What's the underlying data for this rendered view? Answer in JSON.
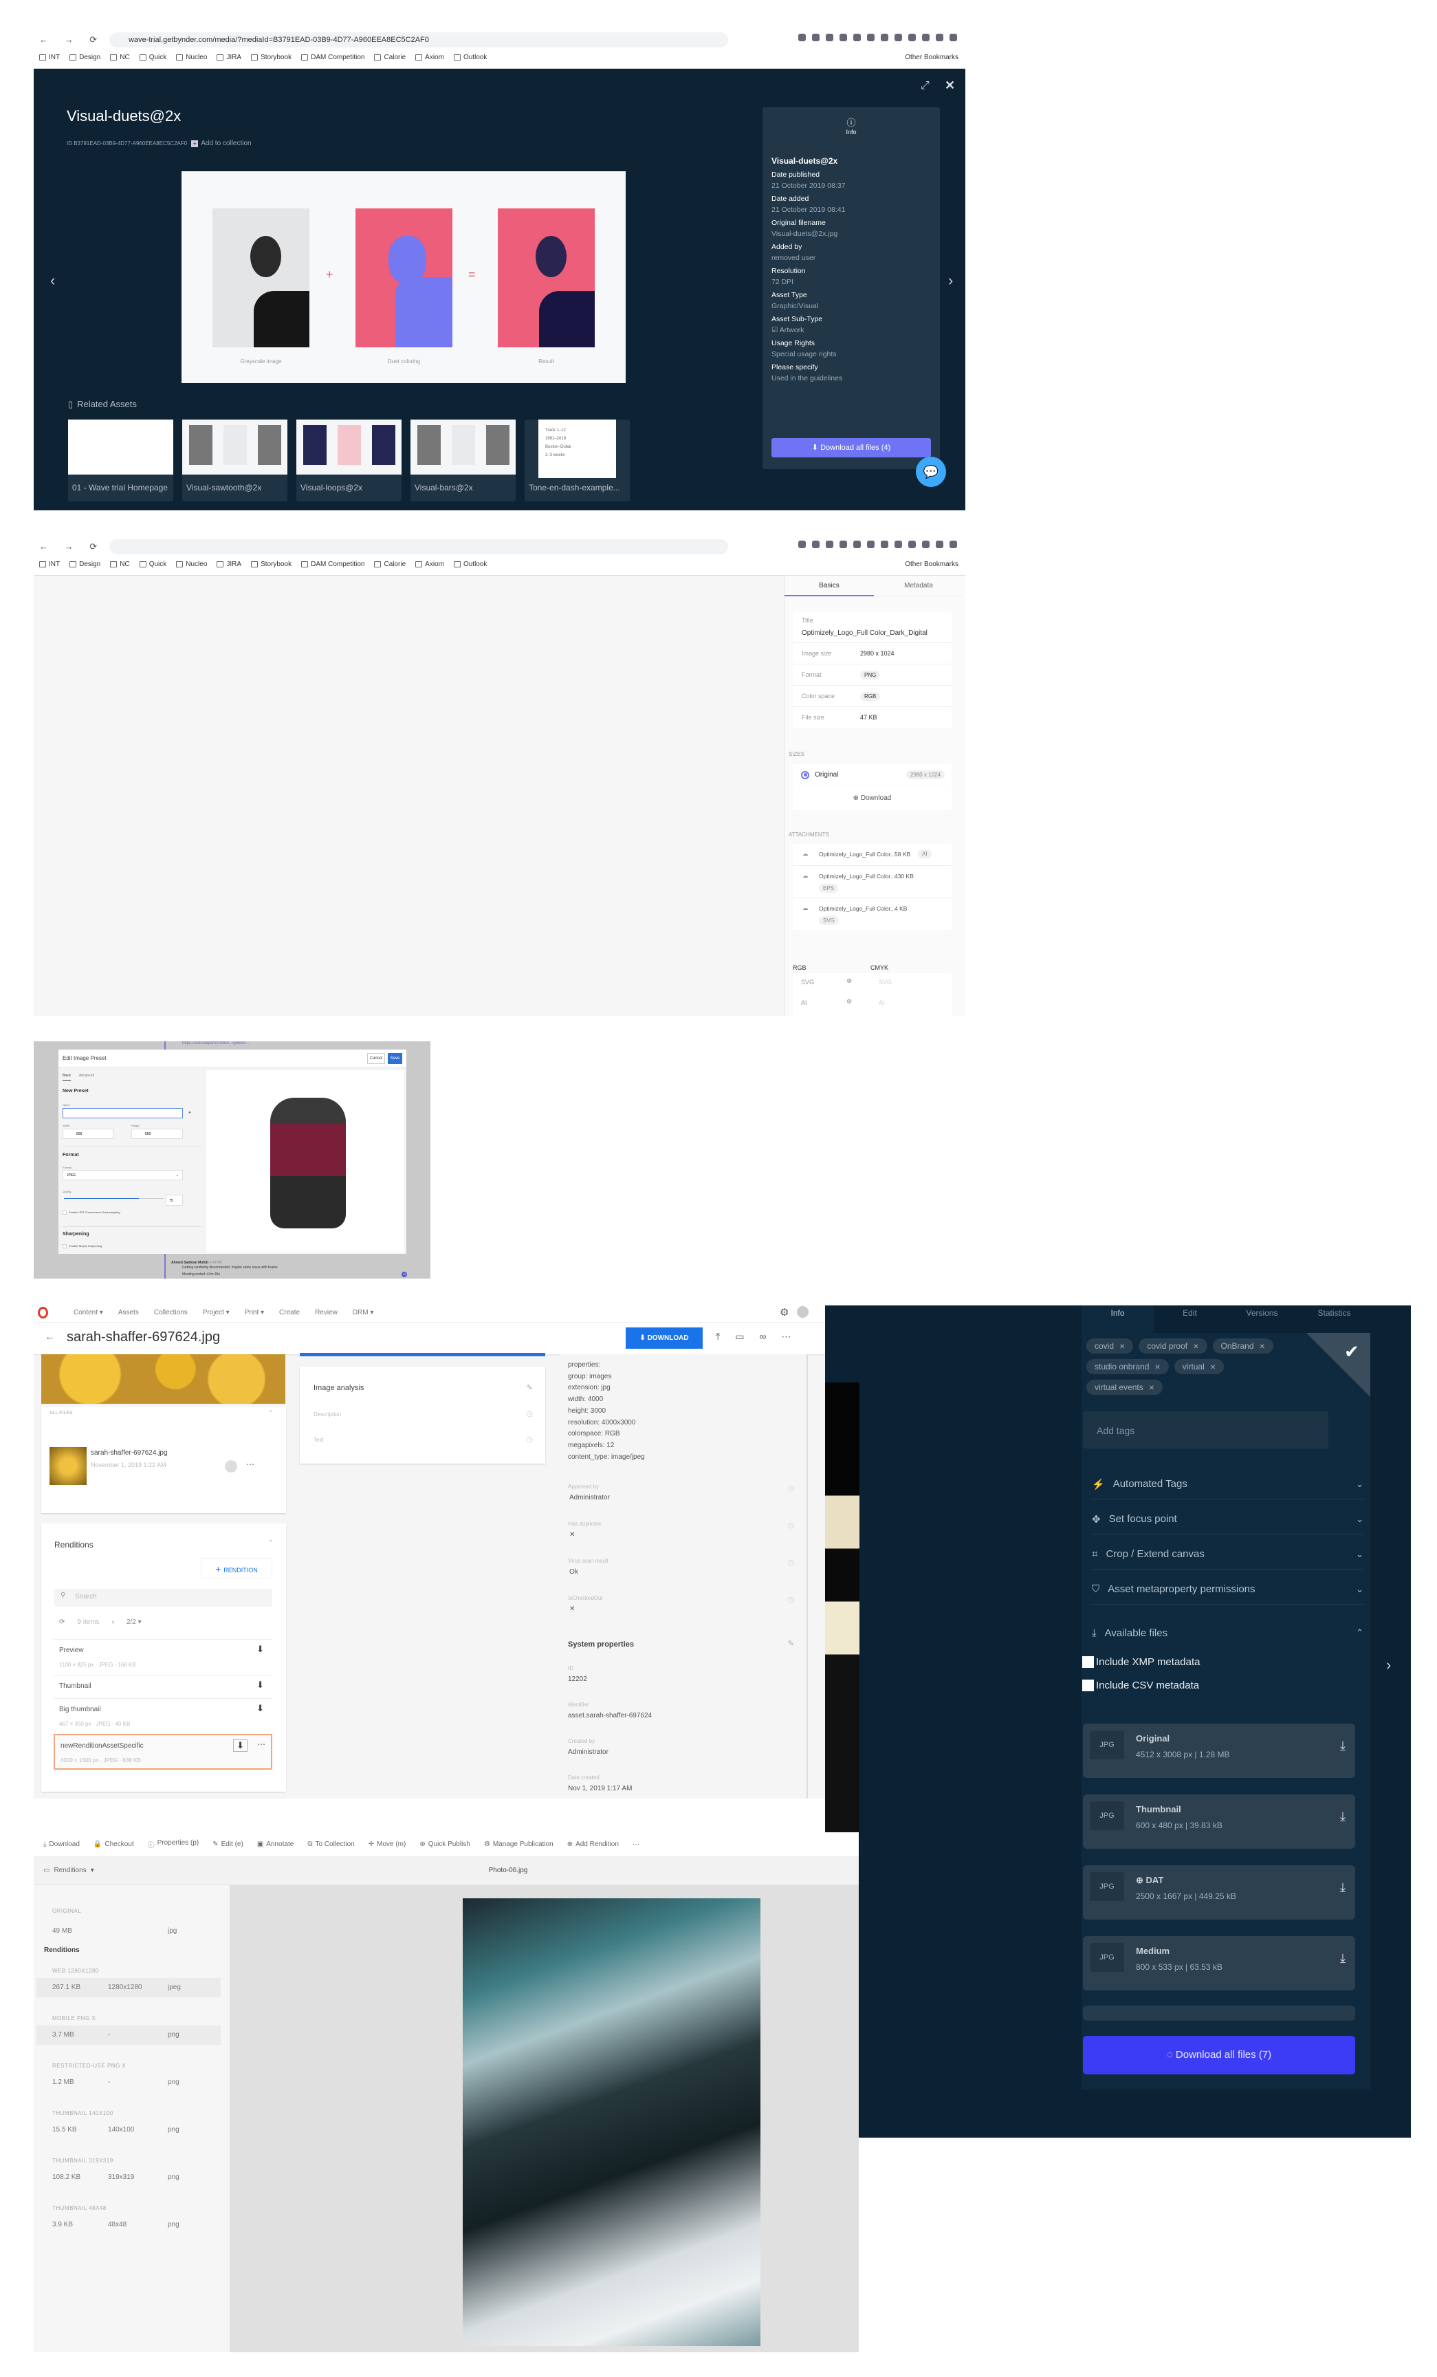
{
  "browser": {
    "bookmarks": [
      "INT",
      "Design",
      "NC",
      "Quick",
      "Nucleo",
      "JIRA",
      "Storybook",
      "DAM Competition",
      "Calorie",
      "Axiom",
      "Outlook"
    ],
    "other_bookmarks": "Other Bookmarks"
  },
  "p1": {
    "url": "wave-trial.getbynder.com/media/?mediaId=B3791EAD-03B9-4D77-A960EEA8EC5C2AF0",
    "title": "Visual-duets@2x",
    "id_line": "ID B3791EAD-03B9-4D77-A960EEA8EC5C2AF0",
    "add_to_collection": "Add to collection",
    "captions": [
      "Greyscale image",
      "Duet coloring",
      "Result"
    ],
    "operators": [
      "+",
      "="
    ],
    "related_label": "Related Assets",
    "related": [
      "01 - Wave trial Homepage",
      "Visual-sawtooth@2x",
      "Visual-loops@2x",
      "Visual-bars@2x",
      "Tone-en-dash-example..."
    ],
    "tone_lines": [
      "Track 1–12",
      "1991–2019",
      "Boston–Dubai",
      "2–3 weeks"
    ],
    "info_tab": "Info",
    "info_title": "Visual-duets@2x",
    "fields": [
      {
        "label": "Date published",
        "value": "21 October 2019 08:37"
      },
      {
        "label": "Date added",
        "value": "21 October 2019 08:41"
      },
      {
        "label": "Original filename",
        "value": "Visual-duets@2x.jpg"
      },
      {
        "label": "Added by",
        "value": "removed user"
      },
      {
        "label": "Resolution",
        "value": "72 DPI"
      },
      {
        "label": "Asset Type",
        "value": "Graphic/Visual"
      },
      {
        "label": "Asset Sub-Type",
        "value": "Artwork"
      },
      {
        "label": "Usage Rights",
        "value": "Special usage rights"
      },
      {
        "label": "Please specify",
        "value": "Used in the guidelines"
      }
    ],
    "download_all": "Download all files (4)",
    "colors": {
      "bg": "#0d2233",
      "panel": "#213747",
      "accent": "#6f74f4",
      "pink": "#ec5e79",
      "violet": "#7479f2",
      "chat": "#3da9fc"
    }
  },
  "p2": {
    "tabs": [
      "Basics",
      "Metadata"
    ],
    "title_label": "Title",
    "title_value": "Optimizely_Logo_Full Color_Dark_Digital",
    "rows": [
      {
        "label": "Image size",
        "value": "2980 x 1024",
        "pill": false
      },
      {
        "label": "Format",
        "value": "PNG",
        "pill": true
      },
      {
        "label": "Color space",
        "value": "RGB",
        "pill": true
      },
      {
        "label": "File size",
        "value": "47 KB",
        "pill": false
      }
    ],
    "sizes_label": "SIZES",
    "size_option": "Original",
    "size_dims": "2980 x 1024",
    "download": "Download",
    "attachments_label": "ATTACHMENTS",
    "attachments": [
      {
        "name": "Optimizely_Logo_Full Color...",
        "size": "58 KB",
        "type": "AI"
      },
      {
        "name": "Optimizely_Logo_Full Color...",
        "size": "430 KB",
        "type": "EPS"
      },
      {
        "name": "Optimizely_Logo_Full Color...",
        "size": "4 KB",
        "type": "SVG"
      }
    ],
    "col_rgb": "RGB",
    "col_cmyk": "CMYK",
    "formats": [
      "SVG",
      "AI"
    ]
  },
  "p3": {
    "chat_link": "https://outsideparrot.mind.../gotoxx...",
    "modal_title": "Edit Image Preset",
    "cancel": "Cancel",
    "save": "Save",
    "tabs": [
      "Basic",
      "Advanced"
    ],
    "section_preset": "New Preset",
    "name_label": "Name",
    "name_value": "",
    "width_label": "Width",
    "width_value": "500",
    "height_label": "Height",
    "height_value": "500",
    "section_format": "Format",
    "format_label": "Format",
    "format_value": "JPEG",
    "quality_label": "Quality",
    "quality_value": "75",
    "quality_percent": 75,
    "chroma_label": "Enable JPG Chrominance Downsampling",
    "section_sharpening": "Sharpening",
    "sharpen_label": "Enable Simple Sharpening",
    "chat_author": "Ahmed Sadman Muhib",
    "chat_time": "4:04 PM",
    "chat_message": "Getting randomly disconnected, maybe some issue with teams",
    "meeting": "Meeting ended: 41m 45s",
    "extra_count": "+2"
  },
  "p4": {
    "nav": [
      "Content ▾",
      "Assets",
      "Collections",
      "Project ▾",
      "Print ▾",
      "Create",
      "Review",
      "DRM ▾"
    ],
    "file_title": "sarah-shaffer-697624.jpg",
    "download": "DOWNLOAD",
    "all_files": "ALL FILES",
    "file_name": "sarah-shaffer-697624.jpg",
    "file_date": "November 1, 2019 1:22 AM",
    "renditions_title": "Renditions",
    "add_rendition": "RENDITION",
    "search_placeholder": "Search",
    "items_count": "9 items",
    "page": "2/2 ▾",
    "renditions": [
      {
        "name": "Preview",
        "meta": "1100 × 825 px · JPEG · 168 KB"
      },
      {
        "name": "Thumbnail",
        "meta": ""
      },
      {
        "name": "Big thumbnail",
        "meta": "467 × 350 px · JPEG · 40 KB"
      },
      {
        "name": "newRenditionAssetSpecific",
        "meta": "4000 × 1500 px · JPEG · 638 KB"
      }
    ],
    "image_analysis": "Image analysis",
    "analysis_fields": [
      "Description",
      "Text"
    ],
    "properties": [
      "properties:",
      "group: images",
      "extension: jpg",
      "width: 4000",
      "height: 3000",
      "resolution: 4000x3000",
      "colorspace: RGB",
      "megapixels: 12",
      "content_type: image/jpeg"
    ],
    "meta": [
      {
        "label": "Approved by",
        "value": "Administrator"
      },
      {
        "label": "Has duplicate",
        "value": "✕"
      },
      {
        "label": "Virus scan result",
        "value": "Ok"
      },
      {
        "label": "IsCheckedOut",
        "value": "✕"
      }
    ],
    "system_title": "System properties",
    "system": [
      {
        "label": "ID",
        "value": "12202"
      },
      {
        "label": "Identifier",
        "value": "asset.sarah-shaffer-697624"
      },
      {
        "label": "Created by",
        "value": "Administrator"
      },
      {
        "label": "Date created",
        "value": "Nov 1, 2019 1:17 AM"
      }
    ],
    "colors": {
      "primary": "#1a73e8",
      "highlight": "#f4a37a"
    }
  },
  "p5": {
    "tabs": [
      "Info",
      "Edit",
      "Versions",
      "Statistics"
    ],
    "tags": [
      "covid",
      "covid proof",
      "OnBrand",
      "studio onbrand",
      "virtual",
      "virtual events"
    ],
    "add_tags_placeholder": "Add tags",
    "sections": [
      {
        "icon": "magic-wand-icon",
        "label": "Automated Tags"
      },
      {
        "icon": "focus-point-icon",
        "label": "Set focus point"
      },
      {
        "icon": "crop-icon",
        "label": "Crop / Extend canvas"
      },
      {
        "icon": "shield-icon",
        "label": "Asset metaproperty permissions"
      }
    ],
    "available_files": "Available files",
    "include_xmp": "Include XMP metadata",
    "include_csv": "Include CSV metadata",
    "files": [
      {
        "ext": "JPG",
        "name": "Original",
        "details": "4512 x 3008 px | 1.28 MB"
      },
      {
        "ext": "JPG",
        "name": "Thumbnail",
        "details": "600 x 480 px | 39.83 kB"
      },
      {
        "ext": "JPG",
        "name": "DAT",
        "details": "2500 x 1667 px | 449.25 kB"
      },
      {
        "ext": "JPG",
        "name": "Medium",
        "details": "800 x 533 px | 63.53 kB"
      }
    ],
    "download_all": "Download all files (7)",
    "colors": {
      "bg": "#0b2234",
      "card": "#2c404f",
      "button": "#3d3cf5"
    }
  },
  "p6": {
    "toolbar": [
      "Download",
      "Checkout",
      "Properties (p)",
      "Edit (e)",
      "Annotate",
      "To Collection",
      "Move (m)",
      "Quick Publish",
      "Manage Publication",
      "Add Rendition",
      "···"
    ],
    "renditions_dropdown": "Renditions",
    "file_title": "Photo-06.jpg",
    "original_label": "ORIGINAL",
    "original": {
      "size": "49 MB",
      "dims": "",
      "type": "jpg"
    },
    "renditions_heading": "Renditions",
    "renditions": [
      {
        "label": "WEB 1280X1280",
        "size": "267.1 KB",
        "dims": "1280x1280",
        "type": "jpeg"
      },
      {
        "label": "MOBILE PNG X",
        "size": "3.7 MB",
        "dims": "-",
        "type": "png"
      },
      {
        "label": "RESTRICTED-USE PNG X",
        "size": "1.2 MB",
        "dims": "-",
        "type": "png"
      },
      {
        "label": "THUMBNAIL 140X100",
        "size": "15.5 KB",
        "dims": "140x100",
        "type": "png"
      },
      {
        "label": "THUMBNAIL 319X319",
        "size": "108.2 KB",
        "dims": "319x319",
        "type": "png"
      },
      {
        "label": "THUMBNAIL 48X48",
        "size": "3.9 KB",
        "dims": "48x48",
        "type": "png"
      }
    ]
  }
}
